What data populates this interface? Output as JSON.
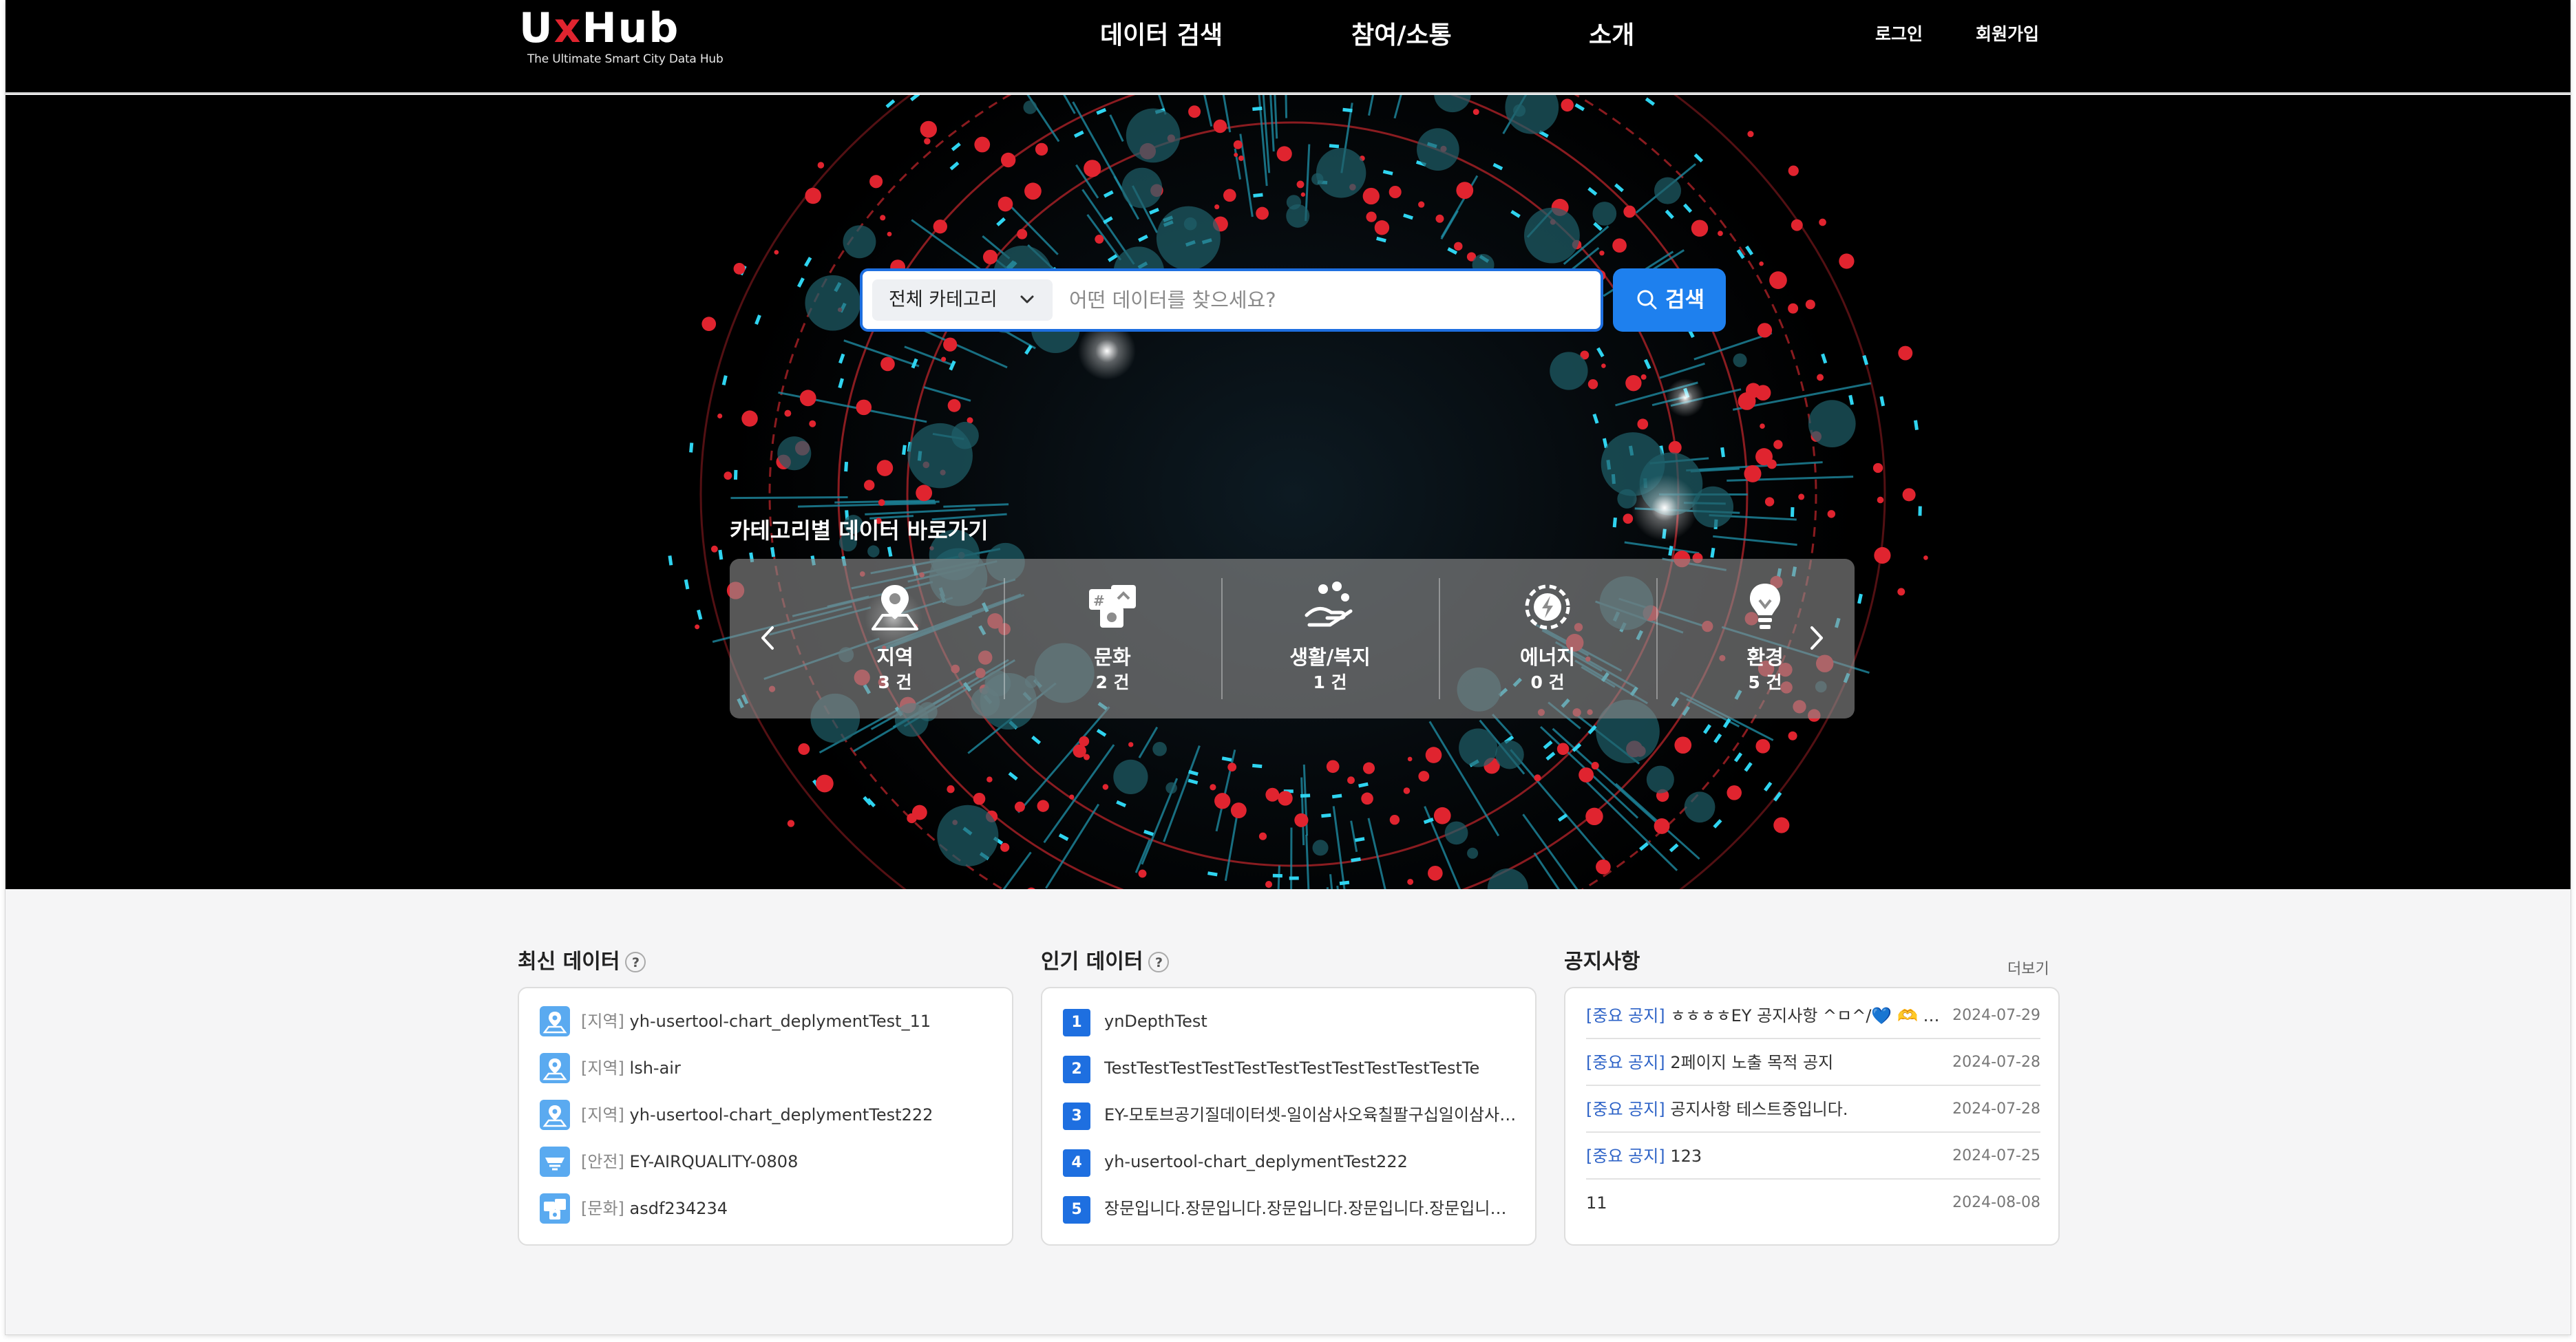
{
  "header": {
    "logo_main": "UxHub",
    "logo_sub": "The Ultimate Smart City Data Hub",
    "nav": [
      "데이터 검색",
      "참여/소통",
      "소개"
    ],
    "login": "로그인",
    "signup": "회원가입"
  },
  "search": {
    "category": "전체 카테고리",
    "placeholder": "어떤 데이터를 찾으세요?",
    "button": "검색"
  },
  "categories": {
    "heading": "카테고리별 데이터 바로가기",
    "items": [
      {
        "name": "지역",
        "count": "3 건",
        "icon": "map-pin-icon"
      },
      {
        "name": "문화",
        "count": "2 건",
        "icon": "culture-icon"
      },
      {
        "name": "생활/복지",
        "count": "1 건",
        "icon": "welfare-icon"
      },
      {
        "name": "에너지",
        "count": "0 건",
        "icon": "energy-icon"
      },
      {
        "name": "환경",
        "count": "5 건",
        "icon": "lightbulb-icon"
      }
    ]
  },
  "latest": {
    "title": "최신 데이터",
    "help": "?",
    "items": [
      {
        "tag": "[지역]",
        "name": "yh-usertool-chart_deplymentTest_11",
        "icon": "map-pin-icon"
      },
      {
        "tag": "[지역]",
        "name": "lsh-air",
        "icon": "map-pin-icon"
      },
      {
        "tag": "[지역]",
        "name": "yh-usertool-chart_deplymentTest222",
        "icon": "map-pin-icon"
      },
      {
        "tag": "[안전]",
        "name": "EY-AIRQUALITY-0808",
        "icon": "safety-icon"
      },
      {
        "tag": "[문화]",
        "name": "asdf234234",
        "icon": "culture-icon"
      }
    ]
  },
  "popular": {
    "title": "인기 데이터",
    "help": "?",
    "items": [
      {
        "rank": "1",
        "name": "ynDepthTest"
      },
      {
        "rank": "2",
        "name": "TestTestTestTestTestTestTestTestTestTestTestTe"
      },
      {
        "rank": "3",
        "name": "EY-모토브공기질데이터셋-일이삼사오육칠팔구십일이삼사오..."
      },
      {
        "rank": "4",
        "name": "yh-usertool-chart_deplymentTest222"
      },
      {
        "rank": "5",
        "name": "장문입니다.장문입니다.장문입니다.장문입니다.장문입니다.장..."
      }
    ]
  },
  "notices": {
    "title": "공지사항",
    "more": "더보기",
    "items": [
      {
        "tag": "[중요 공지]",
        "title": "ㅎㅎㅎㅎEY 공지사항 ^ㅁ^/💙 🫶 💗...",
        "date": "2024-07-29"
      },
      {
        "tag": "[중요 공지]",
        "title": "2페이지 노출 목적 공지",
        "date": "2024-07-28"
      },
      {
        "tag": "[중요 공지]",
        "title": "공지사항 테스트중입니다.",
        "date": "2024-07-28"
      },
      {
        "tag": "[중요 공지]",
        "title": "123",
        "date": "2024-07-25"
      },
      {
        "tag": "",
        "title": "11",
        "date": "2024-08-08"
      }
    ]
  },
  "colors": {
    "accent": "#1e80ee",
    "logo_x": "#e0242f",
    "notice_tag": "#2e63c7"
  }
}
